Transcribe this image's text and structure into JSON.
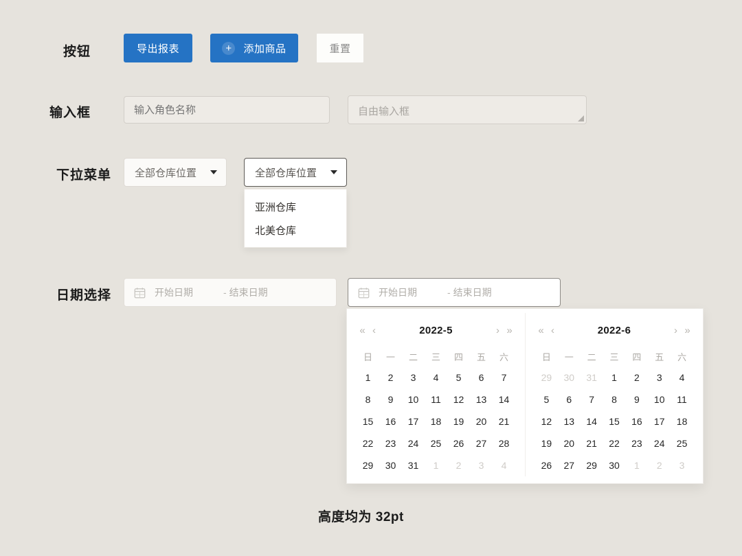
{
  "theme": {
    "background": "#e6e3dd",
    "primary": "#2573c4",
    "panel": "#ffffff",
    "input_bg": "#eeebe6",
    "muted_text": "#a9a6a1"
  },
  "rows": {
    "buttons_label": "按钮",
    "inputs_label": "输入框",
    "dropdown_label": "下拉菜单",
    "datepicker_label": "日期选择"
  },
  "buttons": {
    "export_label": "导出报表",
    "add_label": "添加商品",
    "add_icon": "plus-icon",
    "add_icon_glyph": "+",
    "reset_label": "重置"
  },
  "inputs": {
    "role_placeholder": "输入角色名称",
    "free_placeholder": "自由输入框",
    "role_value": "",
    "free_value": ""
  },
  "dropdowns": {
    "first": {
      "value": "全部仓库位置",
      "caret_icon": "chevron-down-icon"
    },
    "second": {
      "value": "全部仓库位置",
      "caret_icon": "chevron-down-icon",
      "open": true,
      "options": [
        "亚洲仓库",
        "北美仓库"
      ]
    }
  },
  "daterange": {
    "icon": "calendar-icon",
    "start_placeholder": "开始日期",
    "separator": "-",
    "end_placeholder": "结束日期"
  },
  "calendar": {
    "nav": {
      "prev_year": "«",
      "prev_month": "‹",
      "next_month": "›",
      "next_year": "»"
    },
    "weekdays": [
      "日",
      "一",
      "二",
      "三",
      "四",
      "五",
      "六"
    ],
    "panels": [
      {
        "title": "2022-5",
        "weeks": [
          [
            {
              "d": "1",
              "m": false
            },
            {
              "d": "2",
              "m": false
            },
            {
              "d": "3",
              "m": false
            },
            {
              "d": "4",
              "m": false
            },
            {
              "d": "5",
              "m": false
            },
            {
              "d": "6",
              "m": false
            },
            {
              "d": "7",
              "m": false
            }
          ],
          [
            {
              "d": "8",
              "m": false
            },
            {
              "d": "9",
              "m": false
            },
            {
              "d": "10",
              "m": false
            },
            {
              "d": "11",
              "m": false
            },
            {
              "d": "12",
              "m": false
            },
            {
              "d": "13",
              "m": false
            },
            {
              "d": "14",
              "m": false
            }
          ],
          [
            {
              "d": "15",
              "m": false
            },
            {
              "d": "16",
              "m": false
            },
            {
              "d": "17",
              "m": false
            },
            {
              "d": "18",
              "m": false
            },
            {
              "d": "19",
              "m": false
            },
            {
              "d": "20",
              "m": false
            },
            {
              "d": "21",
              "m": false
            }
          ],
          [
            {
              "d": "22",
              "m": false
            },
            {
              "d": "23",
              "m": false
            },
            {
              "d": "24",
              "m": false
            },
            {
              "d": "25",
              "m": false
            },
            {
              "d": "26",
              "m": false
            },
            {
              "d": "27",
              "m": false
            },
            {
              "d": "28",
              "m": false
            }
          ],
          [
            {
              "d": "29",
              "m": false
            },
            {
              "d": "30",
              "m": false
            },
            {
              "d": "31",
              "m": false
            },
            {
              "d": "1",
              "m": true
            },
            {
              "d": "2",
              "m": true
            },
            {
              "d": "3",
              "m": true
            },
            {
              "d": "4",
              "m": true
            }
          ]
        ]
      },
      {
        "title": "2022-6",
        "weeks": [
          [
            {
              "d": "29",
              "m": true
            },
            {
              "d": "30",
              "m": true
            },
            {
              "d": "31",
              "m": true
            },
            {
              "d": "1",
              "m": false
            },
            {
              "d": "2",
              "m": false
            },
            {
              "d": "3",
              "m": false
            },
            {
              "d": "4",
              "m": false
            }
          ],
          [
            {
              "d": "5",
              "m": false
            },
            {
              "d": "6",
              "m": false
            },
            {
              "d": "7",
              "m": false
            },
            {
              "d": "8",
              "m": false
            },
            {
              "d": "9",
              "m": false
            },
            {
              "d": "10",
              "m": false
            },
            {
              "d": "11",
              "m": false
            }
          ],
          [
            {
              "d": "12",
              "m": false
            },
            {
              "d": "13",
              "m": false
            },
            {
              "d": "14",
              "m": false
            },
            {
              "d": "15",
              "m": false
            },
            {
              "d": "16",
              "m": false
            },
            {
              "d": "17",
              "m": false
            },
            {
              "d": "18",
              "m": false
            }
          ],
          [
            {
              "d": "19",
              "m": false
            },
            {
              "d": "20",
              "m": false
            },
            {
              "d": "21",
              "m": false
            },
            {
              "d": "22",
              "m": false
            },
            {
              "d": "23",
              "m": false
            },
            {
              "d": "24",
              "m": false
            },
            {
              "d": "25",
              "m": false
            }
          ],
          [
            {
              "d": "26",
              "m": false
            },
            {
              "d": "27",
              "m": false
            },
            {
              "d": "29",
              "m": false
            },
            {
              "d": "30",
              "m": false
            },
            {
              "d": "1",
              "m": true
            },
            {
              "d": "2",
              "m": true
            },
            {
              "d": "3",
              "m": true
            }
          ]
        ]
      }
    ]
  },
  "caption": "高度均为 32pt"
}
